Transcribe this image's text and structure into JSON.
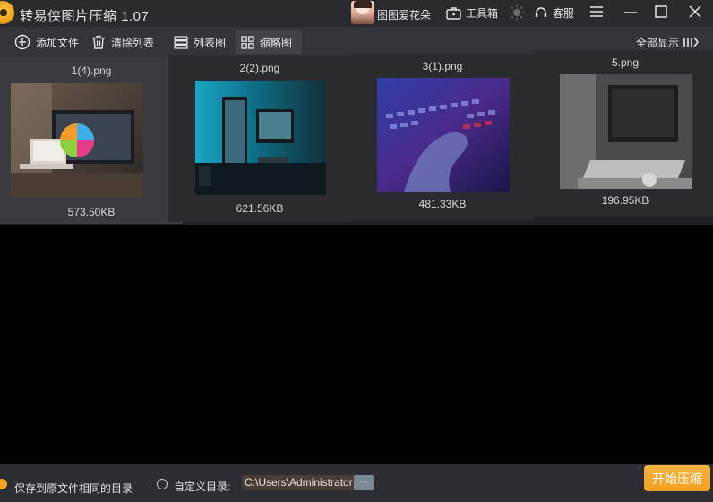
{
  "window": {
    "title": "转易侠图片压缩 1.07",
    "username": "图图爱花朵",
    "toolbox_label": "工具箱",
    "service_label": "客服"
  },
  "toolbar": {
    "add_files": "添加文件",
    "clear_list": "清除列表",
    "list_view": "列表图",
    "thumb_view": "缩略图",
    "show_all": "全部显示"
  },
  "files": [
    {
      "name": "1(4).png",
      "size": "573.50KB",
      "selected": true
    },
    {
      "name": "2(2).png",
      "size": "621.56KB",
      "selected": false
    },
    {
      "name": "3(1).png",
      "size": "481.33KB",
      "selected": false
    },
    {
      "name": "5.png",
      "size": "196.95KB",
      "selected": false
    }
  ],
  "bottom": {
    "save_same_dir": "保存到原文件相同的目录",
    "custom_dir": "自定义目录:",
    "path_value": "C:\\Users\\Administrator",
    "browse": "···",
    "start": "开始压缩"
  },
  "colors": {
    "accent": "#f4a623",
    "background": "#000000",
    "titlebar": "#2a2b2f",
    "toolbar": "#33353a"
  }
}
